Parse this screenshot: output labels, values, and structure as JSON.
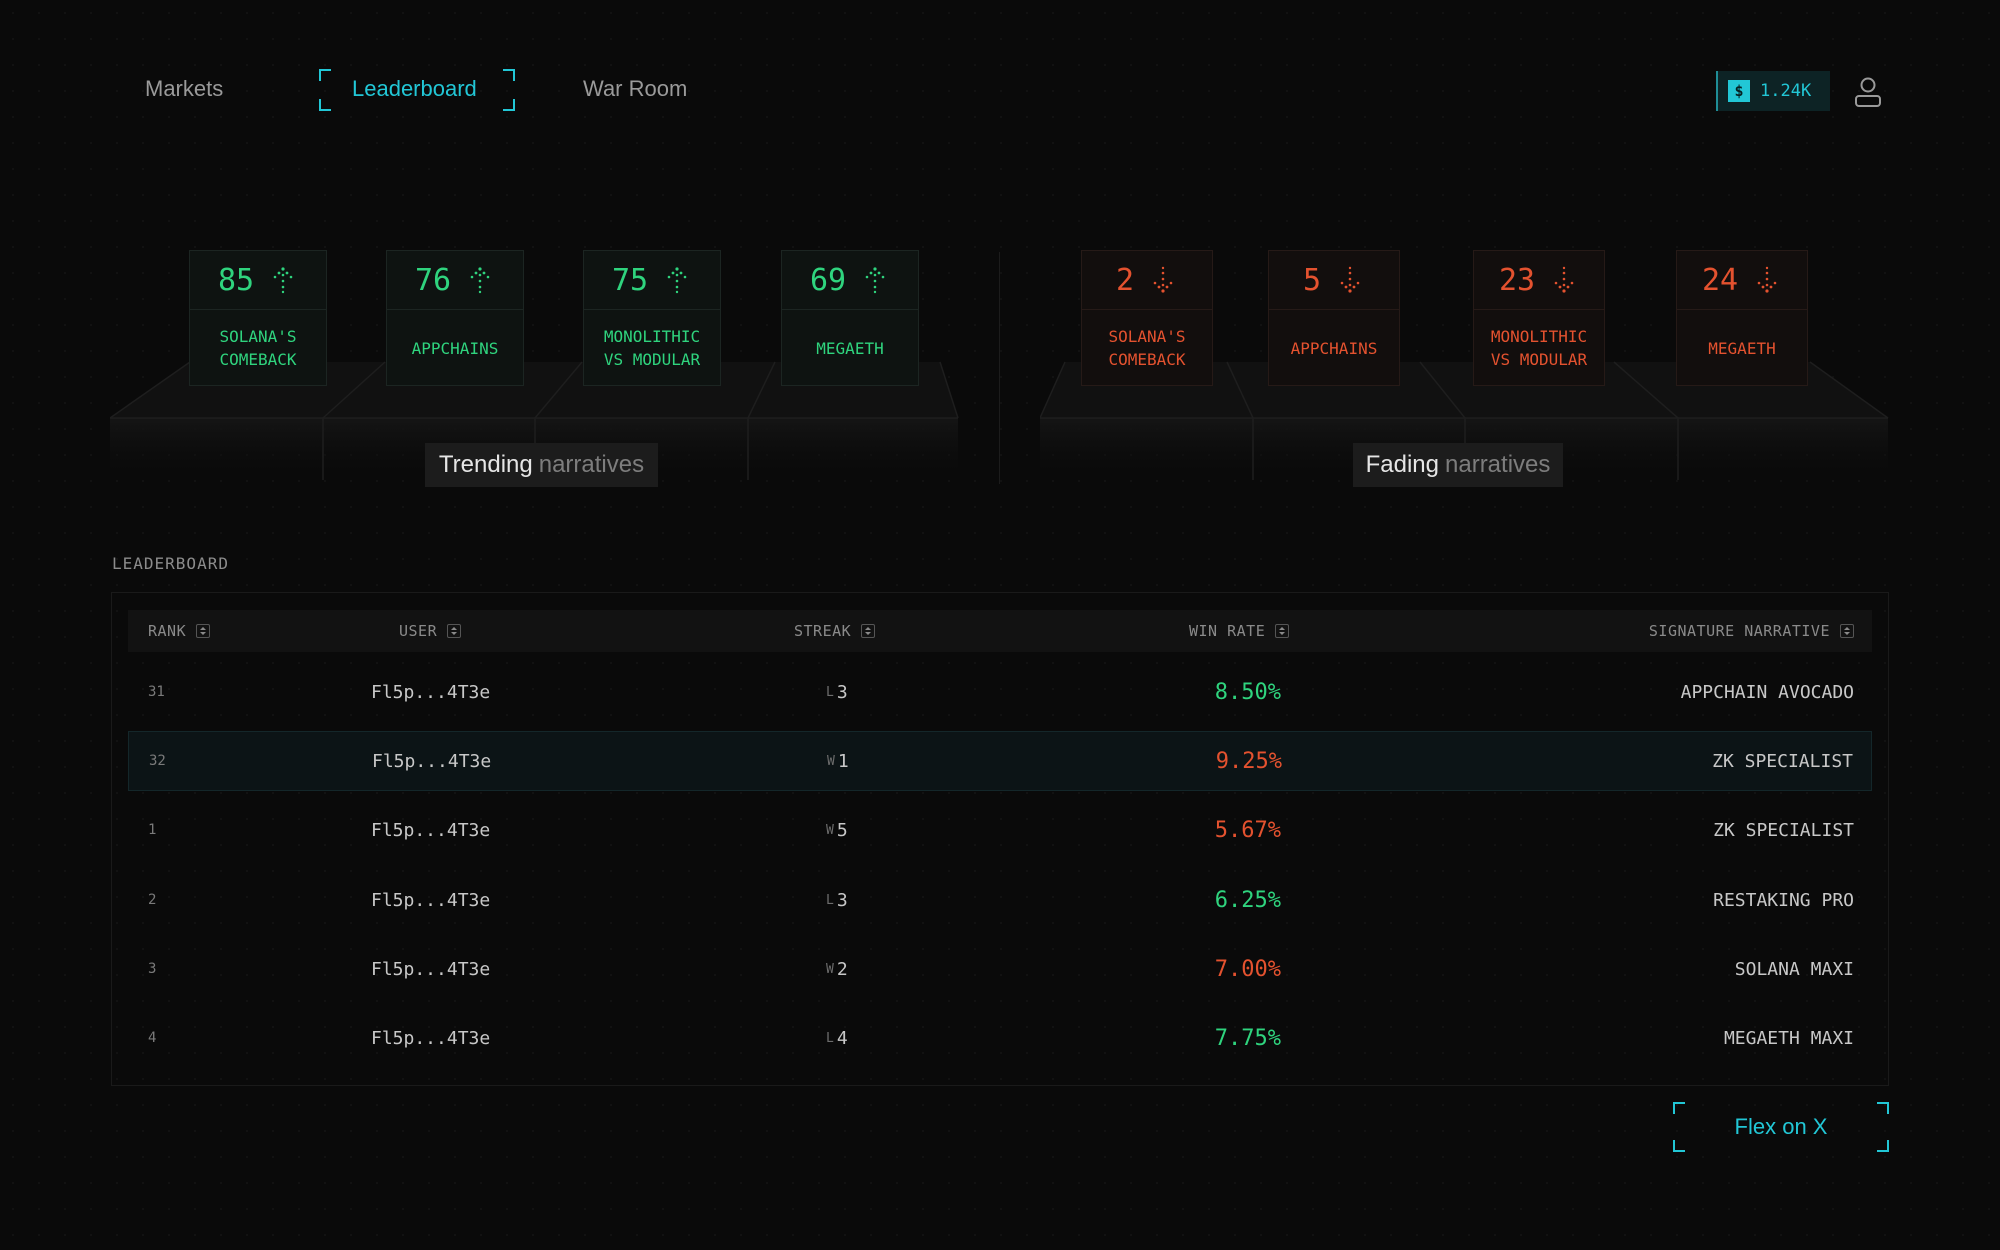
{
  "nav": {
    "items": [
      {
        "label": "Markets"
      },
      {
        "label": "Leaderboard",
        "active": true
      },
      {
        "label": "War Room"
      }
    ]
  },
  "balance": {
    "currency_symbol": "$",
    "value": "1.24K",
    "accent": "#22c7d6"
  },
  "trending": {
    "tag_main": "Trending",
    "tag_dim": "narratives",
    "color": "#2fd47e",
    "cards": [
      {
        "score": "85",
        "label": "SOLANA'S COMEBACK",
        "icon": "arrow-up-icon"
      },
      {
        "score": "76",
        "label": "APPCHAINS",
        "icon": "arrow-up-icon"
      },
      {
        "score": "75",
        "label": "MONOLITHIC VS MODULAR",
        "icon": "arrow-up-icon"
      },
      {
        "score": "69",
        "label": "MEGAETH",
        "icon": "arrow-up-icon"
      }
    ]
  },
  "fading": {
    "tag_main": "Fading",
    "tag_dim": "narratives",
    "color": "#e4522f",
    "cards": [
      {
        "score": "2",
        "label": "SOLANA'S COMEBACK",
        "icon": "arrow-down-icon"
      },
      {
        "score": "5",
        "label": "APPCHAINS",
        "icon": "arrow-down-icon"
      },
      {
        "score": "23",
        "label": "MONOLITHIC VS MODULAR",
        "icon": "arrow-down-icon"
      },
      {
        "score": "24",
        "label": "MEGAETH",
        "icon": "arrow-down-icon"
      }
    ]
  },
  "leaderboard": {
    "title": "LEADERBOARD",
    "columns": {
      "rank": "RANK",
      "user": "USER",
      "streak": "STREAK",
      "win_rate": "WIN RATE",
      "signature": "SIGNATURE NARRATIVE"
    },
    "rows": [
      {
        "rank": "31",
        "user": "Fl5p...4T3e",
        "streak_type": "L",
        "streak_count": "3",
        "win_rate": "8.50%",
        "rate_color": "green",
        "signature": "APPCHAIN AVOCADO",
        "highlighted": false
      },
      {
        "rank": "32",
        "user": "Fl5p...4T3e",
        "streak_type": "W",
        "streak_count": "1",
        "win_rate": "9.25%",
        "rate_color": "red",
        "signature": "ZK SPECIALIST",
        "highlighted": true
      },
      {
        "rank": "1",
        "user": "Fl5p...4T3e",
        "streak_type": "W",
        "streak_count": "5",
        "win_rate": "5.67%",
        "rate_color": "red",
        "signature": "ZK SPECIALIST",
        "highlighted": false
      },
      {
        "rank": "2",
        "user": "Fl5p...4T3e",
        "streak_type": "L",
        "streak_count": "3",
        "win_rate": "6.25%",
        "rate_color": "green",
        "signature": "RESTAKING PRO",
        "highlighted": false
      },
      {
        "rank": "3",
        "user": "Fl5p...4T3e",
        "streak_type": "W",
        "streak_count": "2",
        "win_rate": "7.00%",
        "rate_color": "red",
        "signature": "SOLANA MAXI",
        "highlighted": false
      },
      {
        "rank": "4",
        "user": "Fl5p...4T3e",
        "streak_type": "L",
        "streak_count": "4",
        "win_rate": "7.75%",
        "rate_color": "green",
        "signature": "MEGAETH MAXI",
        "highlighted": false
      }
    ]
  },
  "share_button": {
    "label": "Flex on X"
  }
}
